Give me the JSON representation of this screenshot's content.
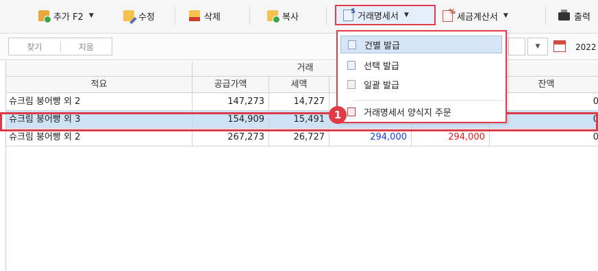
{
  "toolbar": {
    "add_label": "추가 F2",
    "edit_label": "수정",
    "delete_label": "삭제",
    "copy_label": "복사",
    "statement_label": "거래명세서",
    "tax_invoice_label": "세금계산서",
    "print_label": "출력"
  },
  "filter": {
    "find_label": "찾기",
    "clear_label": "지움",
    "date_value": "2022"
  },
  "grid": {
    "group_header": "거래",
    "columns": [
      "적요",
      "공급가액",
      "세액",
      "",
      "",
      "잔액"
    ],
    "rows": [
      {
        "memo": "슈크림 붕어빵 외 2",
        "supply": "147,273",
        "tax": "14,727",
        "total": "",
        "paid": "",
        "balance": "0"
      },
      {
        "memo": "슈크림 붕어빵 외 3",
        "supply": "154,909",
        "tax": "15,491",
        "total": "",
        "paid": "",
        "balance": "0"
      },
      {
        "memo": "슈크림 붕어빵 외 2",
        "supply": "267,273",
        "tax": "26,727",
        "total": "294,000",
        "paid": "294,000",
        "balance": "0"
      }
    ]
  },
  "menu": {
    "items": [
      {
        "label": "건별 발급"
      },
      {
        "label": "선택 발급"
      },
      {
        "label": "일괄 발급"
      },
      {
        "label": "거래명세서 양식지 주문"
      }
    ]
  },
  "callout": "1",
  "colors": {
    "highlight": "#e23b48",
    "selected_row": "#cfe3f7",
    "blue_text": "#1a3fd6",
    "red_text": "#e11a1a"
  }
}
